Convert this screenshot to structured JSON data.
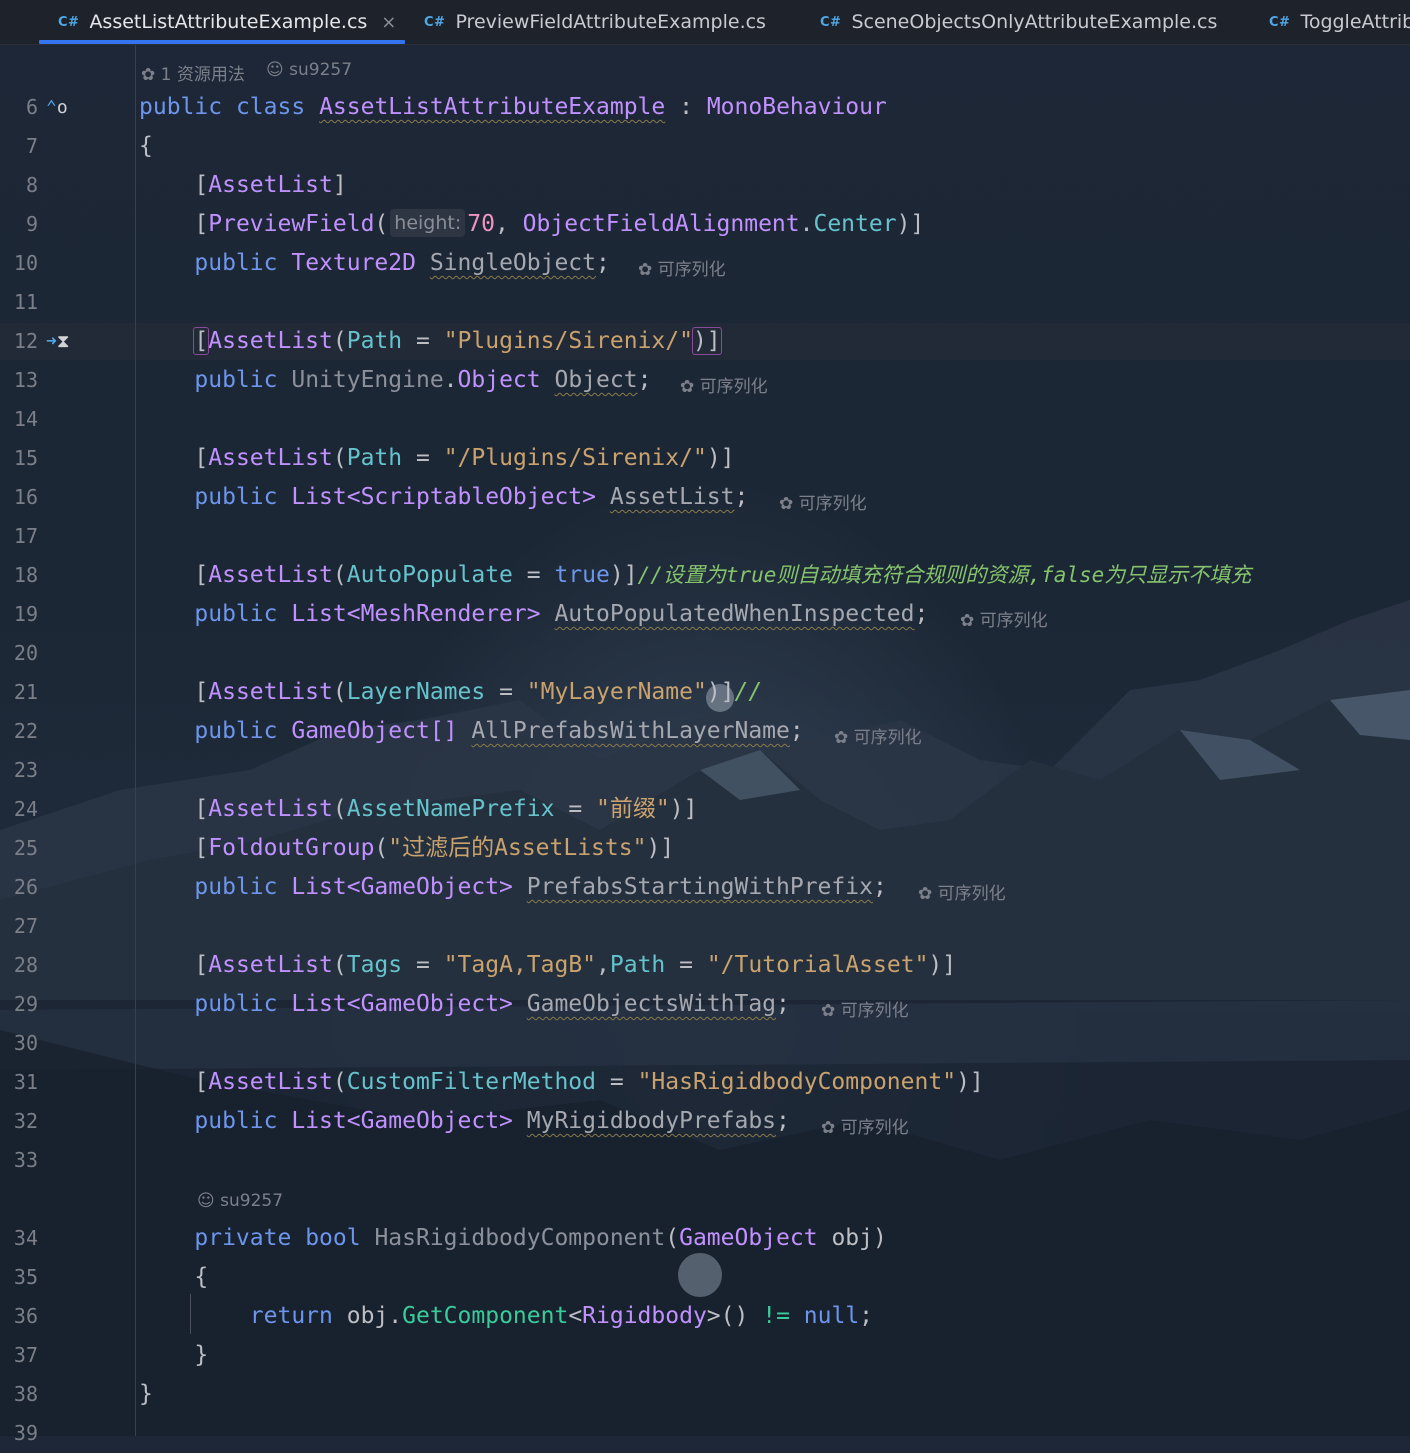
{
  "tabs": [
    {
      "lang": "C#",
      "name": "AssetListAttributeExample.cs",
      "active": true,
      "close": "×"
    },
    {
      "lang": "C#",
      "name": "PreviewFieldAttributeExample.cs"
    },
    {
      "lang": "C#",
      "name": "SceneObjectsOnlyAttributeExample.cs"
    },
    {
      "lang": "C#",
      "name": "ToggleAttrib"
    }
  ],
  "hints": {
    "usages": "1 资源用法",
    "author": "su9257",
    "serializable": "可序列化",
    "param_height": "height:"
  },
  "icons": {
    "usage": "unity-usage-icon",
    "author": "person-icon",
    "implements": "implemented-members-icon",
    "breakpoint": "run-gutter-icon"
  },
  "line_numbers": [
    "6",
    "7",
    "8",
    "9",
    "10",
    "11",
    "12",
    "13",
    "14",
    "15",
    "16",
    "17",
    "18",
    "19",
    "20",
    "21",
    "22",
    "23",
    "24",
    "25",
    "26",
    "27",
    "28",
    "29",
    "30",
    "31",
    "32",
    "33",
    "34",
    "35",
    "36",
    "37",
    "38",
    "39"
  ],
  "code": {
    "l6": {
      "kw1": "public",
      "kw2": "class",
      "cls": "AssetListAttributeExample",
      "colon": ":",
      "base": "MonoBehaviour"
    },
    "l7": {
      "brace": "{"
    },
    "l8": {
      "open": "[",
      "attr": "AssetList",
      "close": "]"
    },
    "l9": {
      "open": "[",
      "attr": "PreviewField",
      "paren": "(",
      "num": "70",
      "comma": ",",
      "type": "ObjectFieldAlignment",
      "dot": ".",
      "member": "Center",
      "end": ")]"
    },
    "l10": {
      "kw": "public",
      "type": "Texture2D",
      "field": "SingleObject",
      "semi": ";"
    },
    "l12": {
      "open": "[",
      "attr": "AssetList",
      "paren": "(",
      "prop": "Path",
      "eq": "=",
      "str": "\"Plugins/Sirenix/\"",
      "end": ")]"
    },
    "l13": {
      "kw": "public",
      "ns": "UnityEngine",
      "dot": ".",
      "type": "Object",
      "field": "Object",
      "semi": ";"
    },
    "l15": {
      "open": "[",
      "attr": "AssetList",
      "paren": "(",
      "prop": "Path",
      "eq": "=",
      "str": "\"/Plugins/Sirenix/\"",
      "end": ")]"
    },
    "l16": {
      "kw": "public",
      "type": "List<ScriptableObject>",
      "field": "AssetList",
      "semi": ";"
    },
    "l18": {
      "open": "[",
      "attr": "AssetList",
      "paren": "(",
      "prop": "AutoPopulate",
      "eq": "=",
      "val": "true",
      "end": ")]",
      "comment": "//设置为true则自动填充符合规则的资源,false为只显示不填充"
    },
    "l19": {
      "kw": "public",
      "type": "List<MeshRenderer>",
      "field": "AutoPopulatedWhenInspected",
      "semi": ";"
    },
    "l21": {
      "open": "[",
      "attr": "AssetList",
      "paren": "(",
      "prop": "LayerNames",
      "eq": "=",
      "str": "\"MyLayerName\"",
      "end": ")]",
      "comment": "//"
    },
    "l22": {
      "kw": "public",
      "type": "GameObject[]",
      "field": "AllPrefabsWithLayerName",
      "semi": ";"
    },
    "l24": {
      "open": "[",
      "attr": "AssetList",
      "paren": "(",
      "prop": "AssetNamePrefix",
      "eq": "=",
      "str": "\"前缀\"",
      "end": ")]"
    },
    "l25": {
      "open": "[",
      "attr": "FoldoutGroup",
      "paren": "(",
      "str": "\"过滤后的AssetLists\"",
      "end": ")]"
    },
    "l26": {
      "kw": "public",
      "type": "List<GameObject>",
      "field": "PrefabsStartingWithPrefix",
      "semi": ";"
    },
    "l28": {
      "open": "[",
      "attr": "AssetList",
      "paren": "(",
      "prop": "Tags",
      "eq": "=",
      "str": "\"TagA,TagB\"",
      "comma": ",",
      "prop2": "Path",
      "eq2": "=",
      "str2": "\"/TutorialAsset\"",
      "end": ")]"
    },
    "l29": {
      "kw": "public",
      "type": "List<GameObject>",
      "field": "GameObjectsWithTag",
      "semi": ";"
    },
    "l31": {
      "open": "[",
      "attr": "AssetList",
      "paren": "(",
      "prop": "CustomFilterMethod",
      "eq": "=",
      "str": "\"HasRigidbodyComponent\"",
      "end": ")]"
    },
    "l32": {
      "kw": "public",
      "type": "List<GameObject>",
      "field": "MyRigidbodyPrefabs",
      "semi": ";"
    },
    "l34": {
      "kw1": "private",
      "kw2": "bool",
      "method": "HasRigidbodyComponent",
      "paren": "(",
      "type": "GameObject",
      "param": "obj",
      "end": ")"
    },
    "l35": {
      "brace": "{"
    },
    "l36": {
      "kw": "return",
      "obj": "obj",
      "dot": ".",
      "method": "GetComponent",
      "lt": "<",
      "type": "Rigidbody",
      "gt": ">",
      "call": "()",
      "op": "!=",
      "null": "null",
      "semi": ";"
    },
    "l37": {
      "brace": "}"
    },
    "l38": {
      "brace": "}"
    }
  }
}
